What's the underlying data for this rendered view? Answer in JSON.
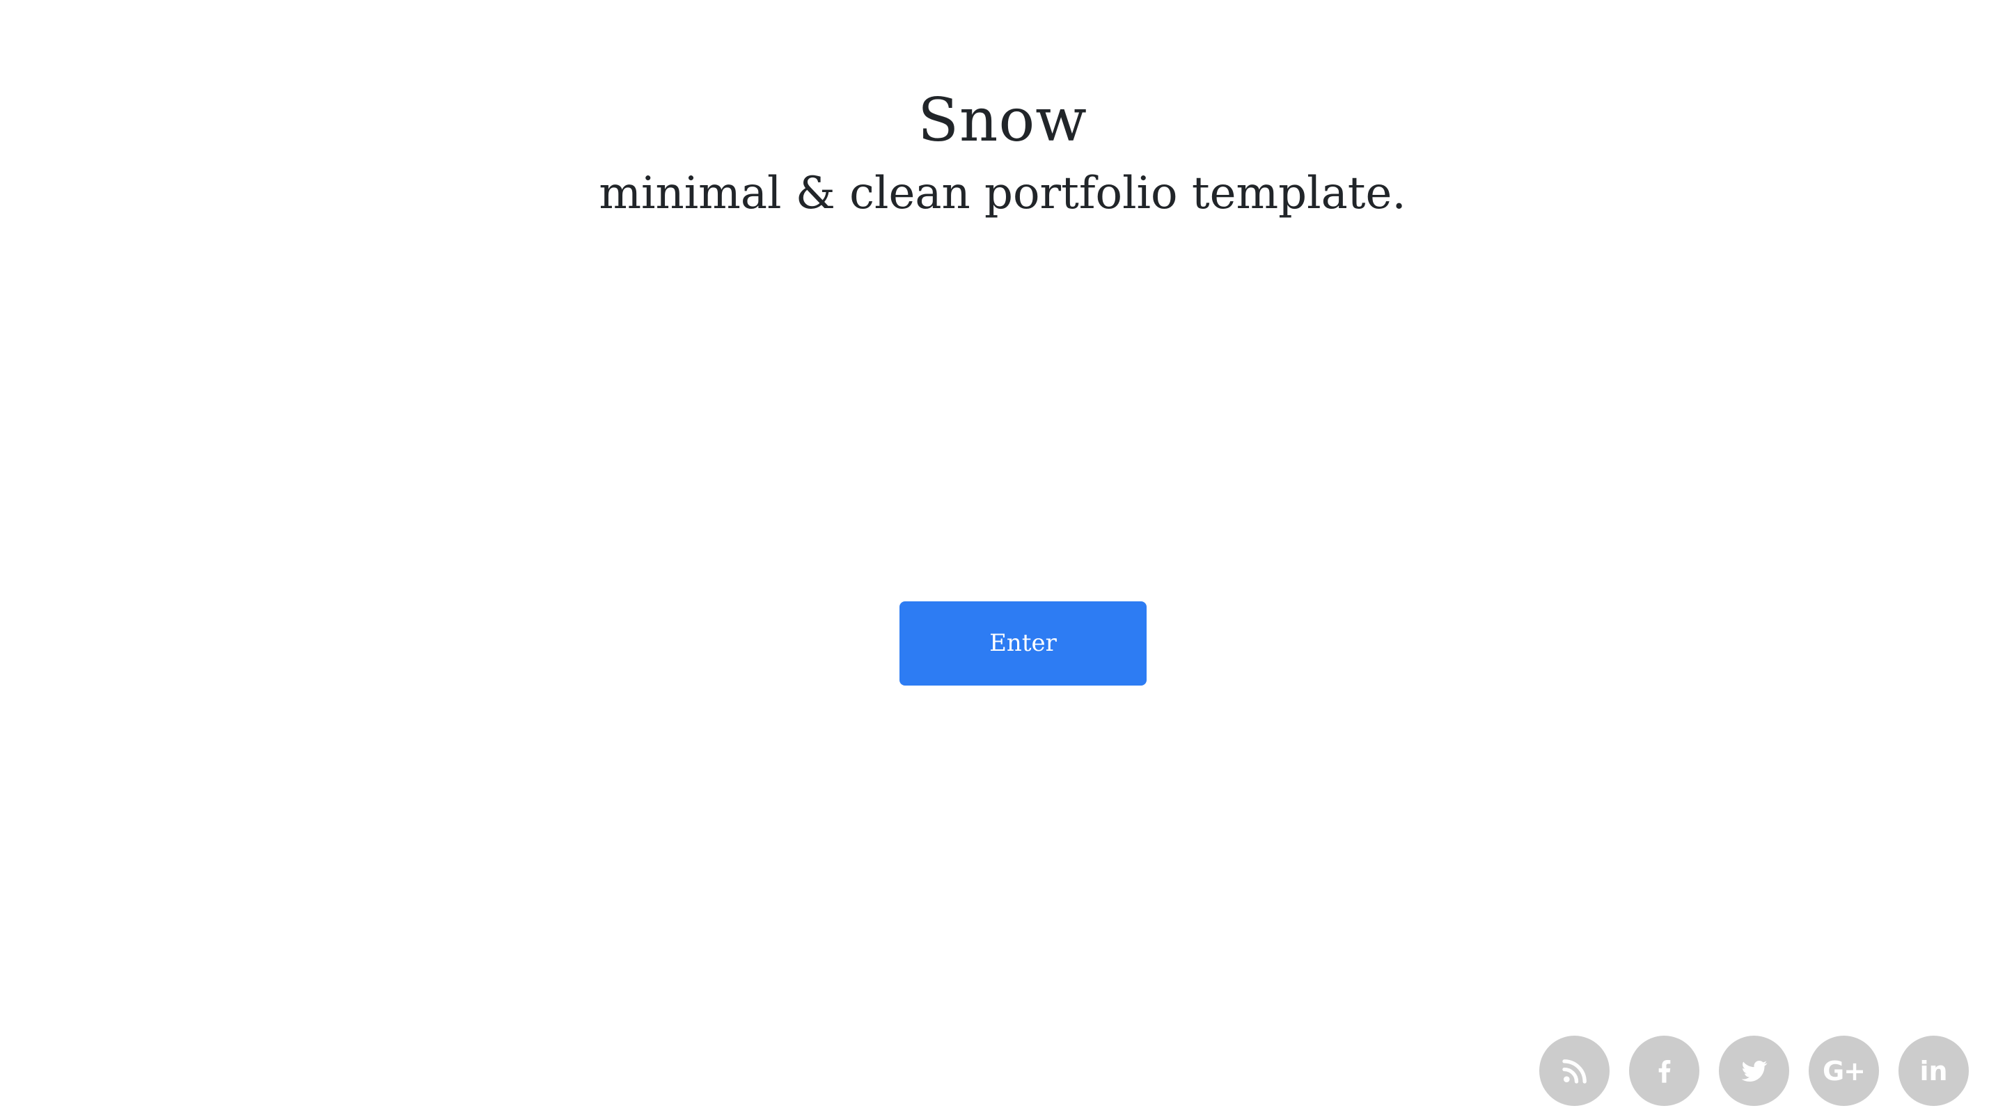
{
  "hero": {
    "title": "Snow",
    "subtitle": "minimal & clean portfolio template."
  },
  "enter_button": {
    "label": "Enter"
  },
  "colors": {
    "button_bg": "#2d7cf3",
    "button_text": "#ffffff",
    "heading": "#212529",
    "social_bg": "#cccccc",
    "social_icon": "#ffffff"
  },
  "social": [
    {
      "name": "rss",
      "icon": "rss-icon"
    },
    {
      "name": "facebook",
      "icon": "facebook-icon"
    },
    {
      "name": "twitter",
      "icon": "twitter-icon"
    },
    {
      "name": "google-plus",
      "icon": "google-plus-icon",
      "glyph": "G+"
    },
    {
      "name": "linkedin",
      "icon": "linkedin-icon",
      "glyph": "in"
    }
  ]
}
